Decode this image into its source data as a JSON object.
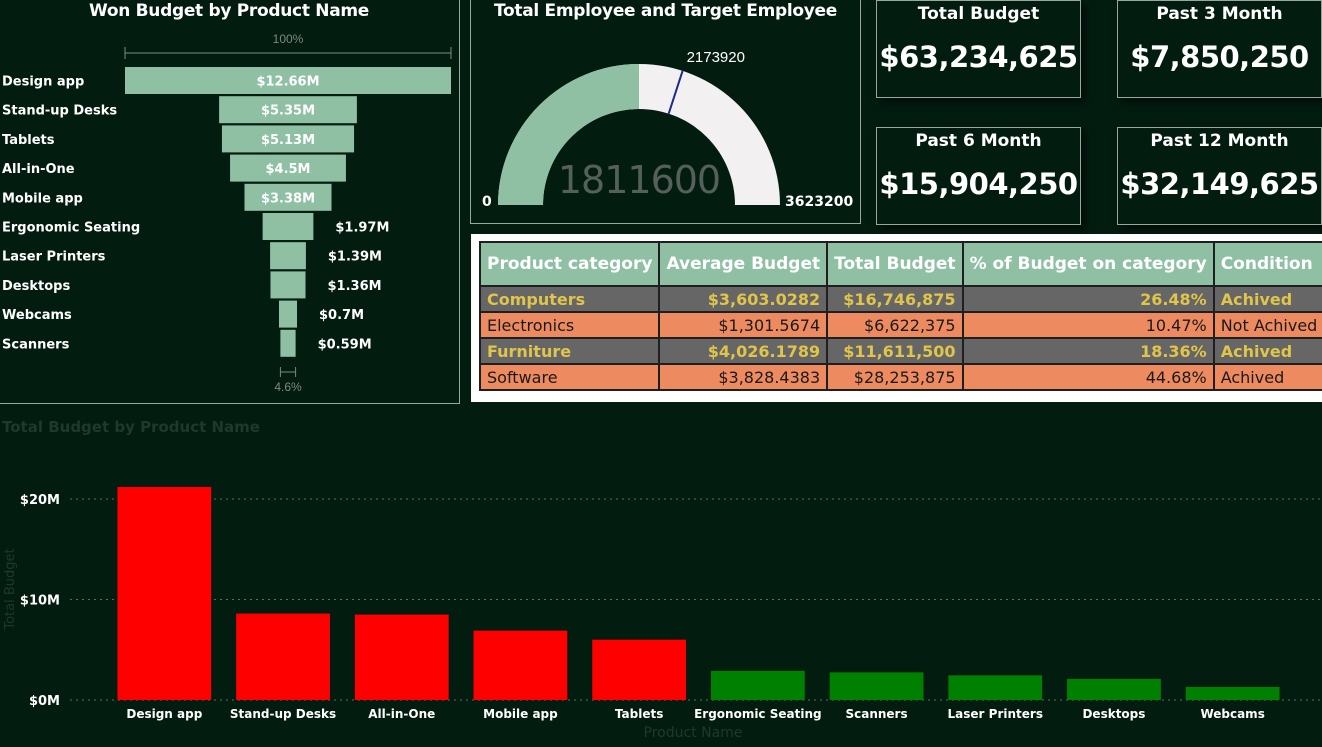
{
  "funnel": {
    "title": "Won Budget by Product Name",
    "top_label": "100%",
    "bottom_label": "4.6%"
  },
  "gauge": {
    "title": "Total Employee and Target Employee",
    "value_label": "1811600",
    "min_label": "0",
    "max_label": "3623200",
    "target_label": "2173920"
  },
  "cards": {
    "total_budget": {
      "title": "Total Budget",
      "value": "$63,234,625"
    },
    "past_3_month": {
      "title": "Past 3 Month",
      "value": "$7,850,250"
    },
    "past_6_month": {
      "title": "Past 6 Month",
      "value": "$15,904,250"
    },
    "past_12_month": {
      "title": "Past 12 Month",
      "value": "$32,149,625"
    }
  },
  "table": {
    "headers": [
      "Product category",
      "Average Budget",
      "Total Budget",
      "% of Budget on category",
      "Condition"
    ],
    "rows": [
      {
        "category": "Computers",
        "average": "$3,603.0282",
        "total": "$16,746,875",
        "percent": "26.48%",
        "condition": "Achived"
      },
      {
        "category": "Electronics",
        "average": "$1,301.5674",
        "total": "$6,622,375",
        "percent": "10.47%",
        "condition": "Not Achived"
      },
      {
        "category": "Furniture",
        "average": "$4,026.1789",
        "total": "$11,611,500",
        "percent": "18.36%",
        "condition": "Achived"
      },
      {
        "category": "Software",
        "average": "$3,828.4383",
        "total": "$28,253,875",
        "percent": "44.68%",
        "condition": "Achived"
      }
    ],
    "colors": {
      "header": "#8fc0a4",
      "gray_row": "#666666",
      "orange_row": "#ee8a60",
      "gold_text": "#e0c54a"
    }
  },
  "bar_chart": {
    "title": "Total Budget by Product Name"
  },
  "chart_data": [
    {
      "type": "bar",
      "orientation": "funnel",
      "title": "Won Budget by Product Name",
      "categories": [
        "Design app",
        "Stand-up Desks",
        "Tablets",
        "All-in-One",
        "Mobile app",
        "Ergonomic Seating",
        "Laser Printers",
        "Desktops",
        "Webcams",
        "Scanners"
      ],
      "values": [
        12.66,
        5.35,
        5.13,
        4.5,
        3.38,
        1.97,
        1.39,
        1.36,
        0.7,
        0.59
      ],
      "data_labels": [
        "$12.66M",
        "$5.35M",
        "$5.13M",
        "$4.5M",
        "$3.38M",
        "$1.97M",
        "$1.39M",
        "$1.36M",
        "$0.7M",
        "$0.59M"
      ],
      "unit": "M",
      "color": "#8fc0a4"
    },
    {
      "type": "gauge",
      "title": "Total Employee and Target Employee",
      "value": 1811600,
      "min": 0,
      "max": 3623200,
      "target": 2173920,
      "fill_color": "#8fc0a4",
      "track_color": "#f2f0f0",
      "target_color": "#1f2a8a"
    },
    {
      "type": "bar",
      "title": "Total Budget by Product Name",
      "xlabel": "Product Name",
      "ylabel": "Total Budget",
      "categories": [
        "Design app",
        "Stand-up Desks",
        "All-in-One",
        "Mobile app",
        "Tablets",
        "Ergonomic Seating",
        "Scanners",
        "Laser Printers",
        "Desktops",
        "Webcams"
      ],
      "values": [
        21.2,
        8.6,
        8.5,
        6.9,
        6.0,
        2.9,
        2.75,
        2.45,
        2.1,
        1.3
      ],
      "colors": [
        "#ff0000",
        "#ff0000",
        "#ff0000",
        "#ff0000",
        "#ff0000",
        "#008000",
        "#008000",
        "#008000",
        "#008000",
        "#008000"
      ],
      "yticks": [
        "$0M",
        "$10M",
        "$20M"
      ],
      "ytick_values": [
        0,
        10,
        20
      ],
      "ylim": [
        0,
        20
      ],
      "grid": true
    }
  ]
}
